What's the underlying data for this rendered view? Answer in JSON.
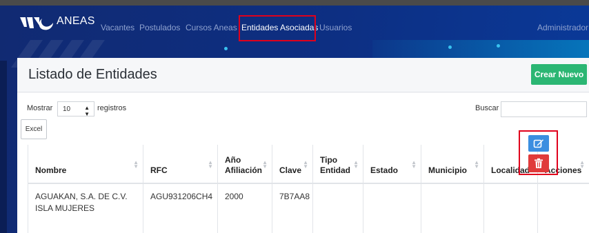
{
  "nav": {
    "brand": "ANEAS",
    "links": [
      "Vacantes",
      "Postulados",
      "Cursos Aneas",
      "Entidades Asociadas",
      "Usuarios"
    ],
    "active_link": "Entidades Asociadas",
    "user": "Administrador"
  },
  "page": {
    "title": "Listado de Entidades",
    "new_button": "Crear Nuevo"
  },
  "controls": {
    "show_label": "Mostrar",
    "page_size": "10",
    "records_label": "registros",
    "search_label": "Buscar",
    "search_value": "",
    "excel_button": "Excel"
  },
  "table": {
    "columns": [
      "Nombre",
      "RFC",
      "Año Afiliación",
      "Clave",
      "Tipo Entidad",
      "Estado",
      "Municipio",
      "Localidad",
      "Acciones"
    ],
    "rows": [
      {
        "nombre": "AGUAKAN, S.A. DE C.V. ISLA MUJERES",
        "rfc": "AGU931206CH4",
        "anio": "2000",
        "clave": "7B7AA8",
        "tipo": "",
        "estado": "",
        "municipio": "",
        "localidad": ""
      }
    ]
  },
  "icons": {
    "edit": "edit-icon",
    "delete": "trash-icon",
    "sort": "sort-icon",
    "logo": "aneas-logo-icon"
  },
  "colors": {
    "nav_bg": "#112a72",
    "create_button": "#2bb673",
    "edit_button": "#3b8ee0",
    "delete_button": "#e03a3a",
    "highlight": "#e0001b"
  }
}
